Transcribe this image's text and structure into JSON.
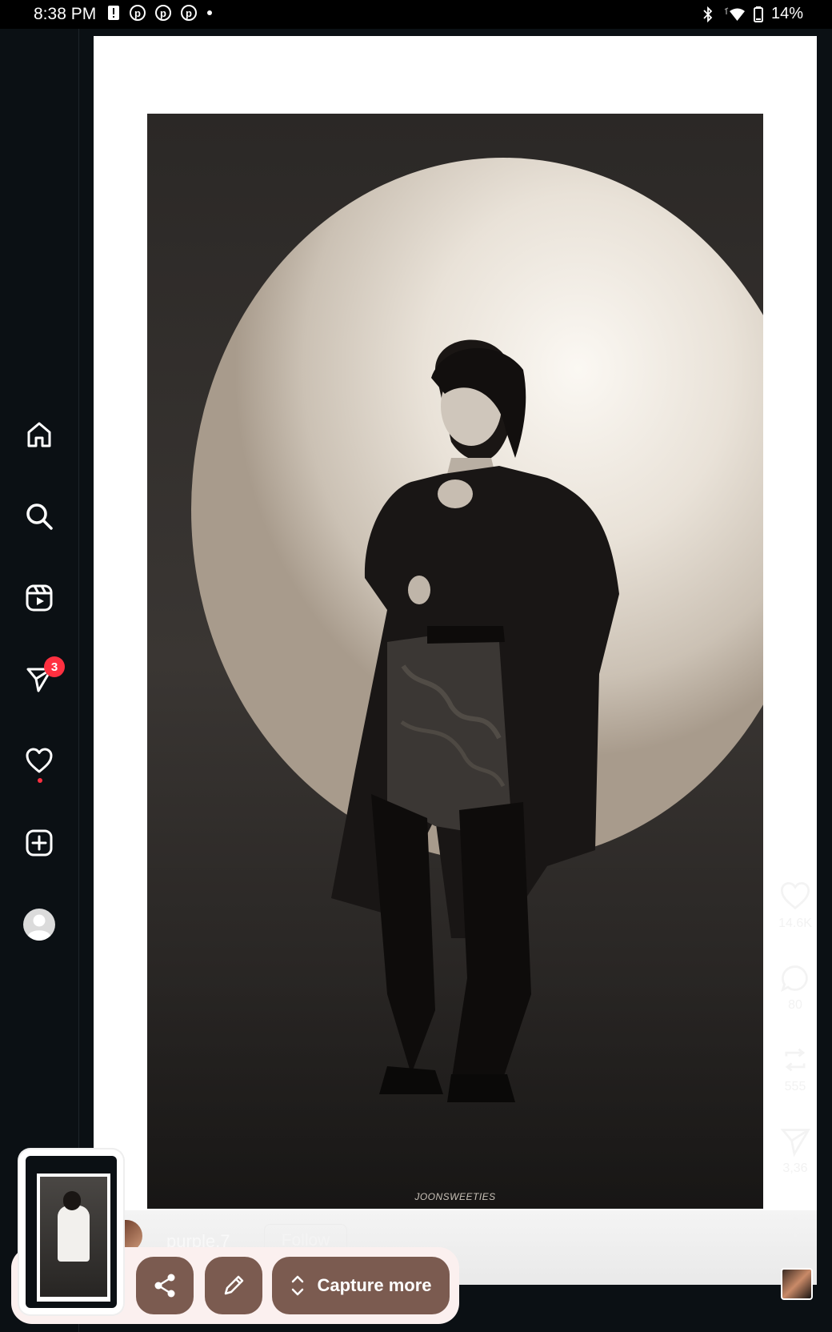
{
  "status_bar": {
    "time": "8:38 PM",
    "battery": "14%",
    "notification_icons": [
      "alert-icon",
      "pinterest-icon",
      "pinterest-icon",
      "pinterest-icon",
      "dot-icon"
    ],
    "right_icons": [
      "bluetooth-icon",
      "wifi-icon",
      "battery-icon"
    ]
  },
  "sidebar": {
    "items": [
      {
        "name": "home",
        "icon": "home-icon"
      },
      {
        "name": "search",
        "icon": "search-icon"
      },
      {
        "name": "reels",
        "icon": "reels-icon"
      },
      {
        "name": "messages",
        "icon": "send-icon",
        "badge": "3"
      },
      {
        "name": "notifications",
        "icon": "heart-icon"
      },
      {
        "name": "create",
        "icon": "plus-square-icon"
      },
      {
        "name": "profile",
        "icon": "avatar-icon"
      }
    ]
  },
  "post": {
    "watermark": "JOONSWEETIES",
    "username": "purple.7",
    "follow_label": "Follow"
  },
  "actions": {
    "likes": "14.6K",
    "comments": "80",
    "reposts": "555",
    "shares": "3,36"
  },
  "capture_toolbar": {
    "share_icon": "share-icon",
    "edit_icon": "pencil-icon",
    "capture_more_label": "Capture more"
  },
  "colors": {
    "background": "#0b1014",
    "badge": "#ff3040",
    "capture_button": "#7b5b50",
    "capture_bar": "#fbf0ef"
  }
}
